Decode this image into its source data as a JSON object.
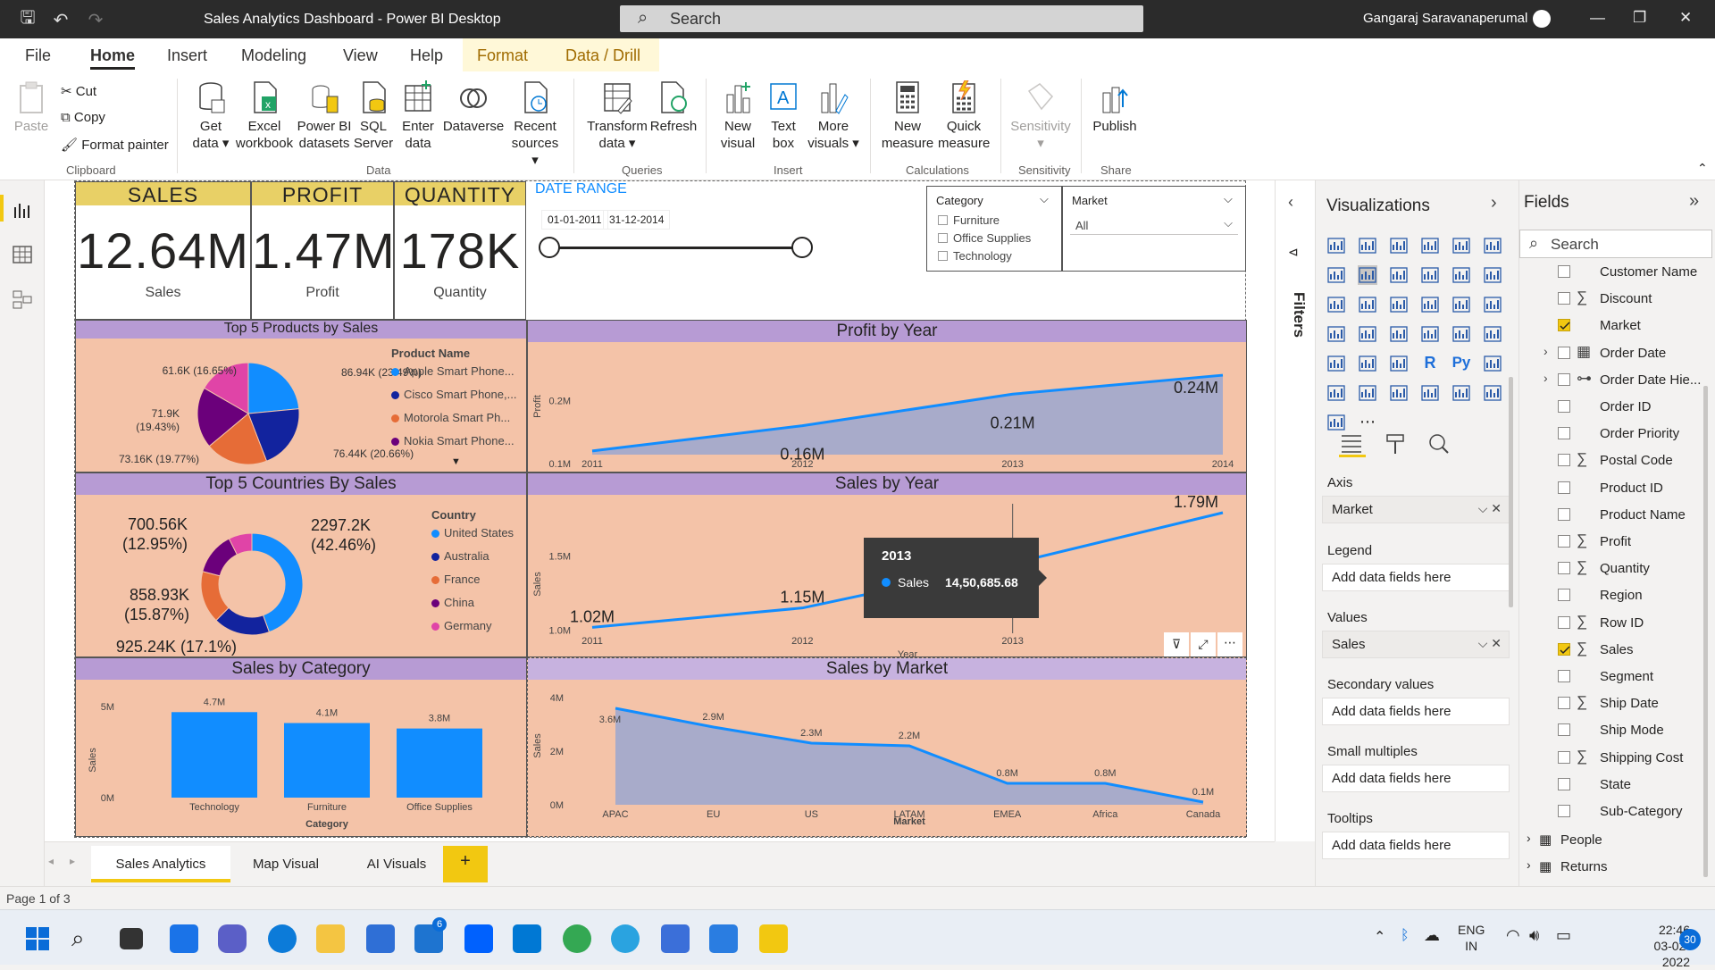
{
  "window": {
    "title": "Sales Analytics Dashboard - Power BI Desktop",
    "search_placeholder": "Search",
    "user": "Gangaraj Saravanaperumal"
  },
  "menu": [
    "File",
    "Home",
    "Insert",
    "Modeling",
    "View",
    "Help",
    "Format",
    "Data / Drill"
  ],
  "ribbon": {
    "clipboard": {
      "paste": "Paste",
      "cut": "Cut",
      "copy": "Copy",
      "format_painter": "Format painter",
      "group": "Clipboard"
    },
    "data": {
      "get_data": "Get data",
      "excel": "Excel workbook",
      "pbi_datasets": "Power BI datasets",
      "sql": "SQL Server",
      "enter_data": "Enter data",
      "dataverse": "Dataverse",
      "recent": "Recent sources",
      "group": "Data"
    },
    "queries": {
      "transform": "Transform data",
      "refresh": "Refresh",
      "group": "Queries"
    },
    "insert": {
      "new_visual": "New visual",
      "text_box": "Text box",
      "more_visuals": "More visuals",
      "group": "Insert"
    },
    "calculations": {
      "new_measure": "New measure",
      "quick_measure": "Quick measure",
      "group": "Calculations"
    },
    "sensitivity": {
      "label": "Sensitivity",
      "group": "Sensitivity"
    },
    "share": {
      "publish": "Publish",
      "group": "Share"
    }
  },
  "kpis": [
    {
      "header": "SALES",
      "value": "12.64M",
      "label": "Sales"
    },
    {
      "header": "PROFIT",
      "value": "1.47M",
      "label": "Profit"
    },
    {
      "header": "QUANTITY",
      "value": "178K",
      "label": "Quantity"
    }
  ],
  "date_range": {
    "title": "DATE RANGE",
    "start": "01-01-2011",
    "end": "31-12-2014"
  },
  "slicers": {
    "category": {
      "title": "Category",
      "options": [
        "Furniture",
        "Office Supplies",
        "Technology"
      ]
    },
    "market": {
      "title": "Market",
      "selected": "All"
    }
  },
  "visuals": {
    "top_products": {
      "title": "Top 5 Products by Sales",
      "legend_title": "Product Name",
      "legend": [
        "Apple Smart Phone...",
        "Cisco Smart Phone,...",
        "Motorola Smart Ph...",
        "Nokia Smart Phone..."
      ]
    },
    "top_countries": {
      "title": "Top 5 Countries By Sales",
      "legend_title": "Country",
      "legend": [
        "United States",
        "Australia",
        "France",
        "China",
        "Germany"
      ]
    },
    "profit_year": {
      "title": "Profit by Year",
      "ylabel": "Profit"
    },
    "sales_year": {
      "title": "Sales by Year",
      "ylabel": "Sales",
      "xlabel": "Year",
      "tooltip_title": "2013",
      "tooltip_label": "Sales",
      "tooltip_value": "14,50,685.68"
    },
    "sales_category": {
      "title": "Sales by Category",
      "ylabel": "Sales",
      "xlabel": "Category"
    },
    "sales_market": {
      "title": "Sales by Market",
      "ylabel": "Sales",
      "xlabel": "Market"
    }
  },
  "colors": {
    "accent_blue": "#118dff",
    "navy": "#12239e",
    "orange": "#e66c37",
    "purple": "#6b007b",
    "pink": "#e044a7",
    "kpi_header": "#e8d066",
    "panel_bg": "#f4c3a8",
    "panel_header": "#b79bd4"
  },
  "chart_data": [
    {
      "type": "pie",
      "title": "Top 5 Products by Sales",
      "categories": [
        "Apple Smart Phone...",
        "Cisco Smart Phone,...",
        "Motorola Smart Ph...",
        "Nokia Smart Phone...",
        ""
      ],
      "values": [
        86.94,
        76.44,
        73.16,
        71.9,
        61.6
      ],
      "labels": [
        "86.94K (23.49%)",
        "76.44K (20.66%)",
        "73.16K (19.77%)",
        "71.9K (19.43%)",
        "61.6K (16.65%)"
      ],
      "colors": [
        "#118dff",
        "#12239e",
        "#e66c37",
        "#6b007b",
        "#e044a7"
      ]
    },
    {
      "type": "pie",
      "title": "Top 5 Countries By Sales",
      "categories": [
        "United States",
        "Australia",
        "France",
        "China",
        "Germany"
      ],
      "values": [
        2297.2,
        925.24,
        858.93,
        700.56,
        0
      ],
      "labels": [
        "2297.2K (42.46%)",
        "925.24K (17.1%)",
        "858.93K (15.87%)",
        "700.56K (12.95%)",
        ""
      ],
      "colors": [
        "#118dff",
        "#12239e",
        "#e66c37",
        "#6b007b",
        "#e044a7"
      ]
    },
    {
      "type": "area",
      "title": "Profit by Year",
      "x": [
        "2011",
        "2012",
        "2013",
        "2014"
      ],
      "values": [
        0.12,
        0.16,
        0.21,
        0.24
      ],
      "labels": [
        "",
        "0.16M",
        "0.21M",
        "0.24M"
      ],
      "yticks": [
        "0.1M",
        "0.2M"
      ],
      "ylim": [
        0.1,
        0.25
      ],
      "ylabel": "Profit"
    },
    {
      "type": "line",
      "title": "Sales by Year",
      "x": [
        "2011",
        "2012",
        "2013",
        "2014"
      ],
      "values": [
        1.02,
        1.15,
        1.45,
        1.79
      ],
      "labels": [
        "1.02M",
        "1.15M",
        "1.45M",
        "1.79M"
      ],
      "yticks": [
        "1.0M",
        "1.5M"
      ],
      "ylim": [
        0.98,
        1.85
      ],
      "xlabel": "Year",
      "ylabel": "Sales"
    },
    {
      "type": "bar",
      "title": "Sales by Category",
      "categories": [
        "Technology",
        "Furniture",
        "Office Supplies"
      ],
      "values": [
        4.7,
        4.1,
        3.8
      ],
      "labels": [
        "4.7M",
        "4.1M",
        "3.8M"
      ],
      "yticks": [
        "0M",
        "5M"
      ],
      "ylim": [
        0,
        5.5
      ],
      "xlabel": "Category",
      "ylabel": "Sales"
    },
    {
      "type": "area",
      "title": "Sales by Market",
      "categories": [
        "APAC",
        "EU",
        "US",
        "LATAM",
        "EMEA",
        "Africa",
        "Canada"
      ],
      "values": [
        3.6,
        2.9,
        2.3,
        2.2,
        0.8,
        0.8,
        0.1
      ],
      "labels": [
        "3.6M",
        "2.9M",
        "2.3M",
        "2.2M",
        "0.8M",
        "0.8M",
        "0.1M"
      ],
      "yticks": [
        "0M",
        "2M",
        "4M"
      ],
      "ylim": [
        0,
        4.2
      ],
      "xlabel": "Market",
      "ylabel": "Sales"
    }
  ],
  "viz_pane": {
    "title": "Visualizations",
    "wells": [
      {
        "label": "Axis",
        "value": "Market",
        "filled": true
      },
      {
        "label": "Legend",
        "value": "Add data fields here",
        "filled": false
      },
      {
        "label": "Values",
        "value": "Sales",
        "filled": true
      },
      {
        "label": "Secondary values",
        "value": "Add data fields here",
        "filled": false
      },
      {
        "label": "Small multiples",
        "value": "Add data fields here",
        "filled": false
      },
      {
        "label": "Tooltips",
        "value": "Add data fields here",
        "filled": false
      }
    ]
  },
  "filters_label": "Filters",
  "fields_pane": {
    "title": "Fields",
    "search_placeholder": "Search",
    "fields": [
      {
        "name": "Customer Name",
        "sigma": false,
        "checked": false
      },
      {
        "name": "Discount",
        "sigma": true,
        "checked": false
      },
      {
        "name": "Market",
        "sigma": false,
        "checked": true
      },
      {
        "name": "Order Date",
        "sigma": false,
        "checked": false,
        "icon": "calendar"
      },
      {
        "name": "Order Date Hie...",
        "sigma": false,
        "checked": false,
        "icon": "hierarchy"
      },
      {
        "name": "Order ID",
        "sigma": false,
        "checked": false
      },
      {
        "name": "Order Priority",
        "sigma": false,
        "checked": false
      },
      {
        "name": "Postal Code",
        "sigma": true,
        "checked": false
      },
      {
        "name": "Product ID",
        "sigma": false,
        "checked": false
      },
      {
        "name": "Product Name",
        "sigma": false,
        "checked": false
      },
      {
        "name": "Profit",
        "sigma": true,
        "checked": false
      },
      {
        "name": "Quantity",
        "sigma": true,
        "checked": false
      },
      {
        "name": "Region",
        "sigma": false,
        "checked": false
      },
      {
        "name": "Row ID",
        "sigma": true,
        "checked": false
      },
      {
        "name": "Sales",
        "sigma": true,
        "checked": true
      },
      {
        "name": "Segment",
        "sigma": false,
        "checked": false
      },
      {
        "name": "Ship Date",
        "sigma": true,
        "checked": false
      },
      {
        "name": "Ship Mode",
        "sigma": false,
        "checked": false
      },
      {
        "name": "Shipping Cost",
        "sigma": true,
        "checked": false
      },
      {
        "name": "State",
        "sigma": false,
        "checked": false
      },
      {
        "name": "Sub-Category",
        "sigma": false,
        "checked": false
      }
    ],
    "tables": [
      "People",
      "Returns"
    ]
  },
  "page_tabs": [
    "Sales Analytics",
    "Map Visual",
    "AI Visuals"
  ],
  "status": "Page 1 of 3",
  "tray": {
    "lang": "ENG",
    "region": "IN",
    "time": "22:46",
    "date": "03-02-2022",
    "notif": "30",
    "mail_badge": "6"
  }
}
